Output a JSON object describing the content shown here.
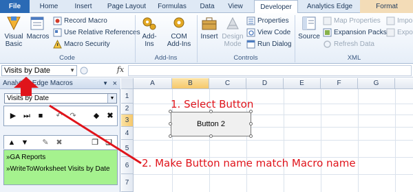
{
  "tabs": [
    "File",
    "Home",
    "Insert",
    "Page Layout",
    "Formulas",
    "Data",
    "View",
    "Developer",
    "Analytics Edge",
    "Format"
  ],
  "active_tab": "Developer",
  "ribbon": {
    "code": {
      "label": "Code",
      "visual_basic": "Visual Basic",
      "macros": "Macros",
      "record_macro": "Record Macro",
      "relative_refs": "Use Relative References",
      "macro_security": "Macro Security"
    },
    "addins": {
      "label": "Add-Ins",
      "addins": "Add-Ins",
      "com_addins": "COM Add-Ins"
    },
    "controls": {
      "label": "Controls",
      "insert": "Insert",
      "design_mode": "Design Mode",
      "properties": "Properties",
      "view_code": "View Code",
      "run_dialog": "Run Dialog"
    },
    "xml": {
      "label": "XML",
      "source": "Source",
      "map_properties": "Map Properties",
      "expansion_packs": "Expansion Packs",
      "refresh_data": "Refresh Data",
      "import": "Impor",
      "export": "Expor"
    }
  },
  "formula_bar": {
    "name_box": "Visits by Date",
    "fx": "fx",
    "value": ""
  },
  "pane": {
    "title": "Analytics Edge Macros",
    "selected_macro": "Visits by Date",
    "macros": [
      "»GA Reports",
      "»WriteToWorksheet Visits by Date"
    ]
  },
  "grid": {
    "columns": [
      "A",
      "B",
      "C",
      "D",
      "E",
      "F",
      "G"
    ],
    "selected_column": "B",
    "rows": [
      "1",
      "2",
      "3",
      "4",
      "5",
      "6",
      "7"
    ],
    "selected_row": "3"
  },
  "form_button": {
    "label": "Button 2"
  },
  "annotations": {
    "step1": "1. Select Button",
    "step2": "2. Make Button name match Macro name"
  },
  "colors": {
    "file_tab": "#2a6ab5",
    "annotation": "#e0141b",
    "macro_list_bg": "#a5f28e",
    "context_band": "#f3dcb7"
  }
}
